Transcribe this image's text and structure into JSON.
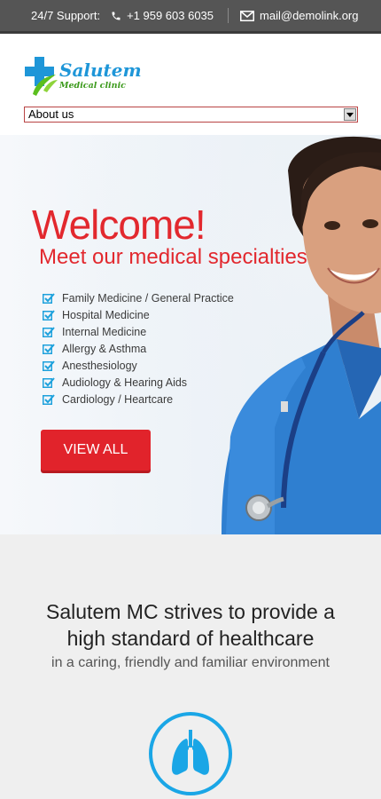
{
  "topbar": {
    "support_label": "24/7 Support:",
    "phone": "+1 959 603 6035",
    "email": "mail@demolink.org",
    "icons": {
      "phone": "phone-icon",
      "email": "mail-icon"
    }
  },
  "header": {
    "logo_name": "Salutem",
    "logo_sub": "Medical clinic",
    "nav_selected": "About us"
  },
  "hero": {
    "welcome": "Welcome!",
    "subtitle": "Meet our medical specialties",
    "specialties": [
      "Family Medicine / General Practice",
      "Hospital Medicine",
      "Internal Medicine",
      "Allergy & Asthma",
      "Anesthesiology",
      "Audiology & Hearing Aids",
      "Cardiology / Heartcare"
    ],
    "button": "VIEW ALL"
  },
  "mission": {
    "title": "Salutem MC strives to provide a high standard of healthcare",
    "subtitle": "in a caring, friendly and familiar environment",
    "icon": "lungs-icon"
  },
  "colors": {
    "accent_red": "#e2282e",
    "brand_blue": "#1e96d8",
    "brand_green": "#3c9a1c",
    "topbar": "#555555",
    "icon_blue": "#1aa6e6"
  }
}
